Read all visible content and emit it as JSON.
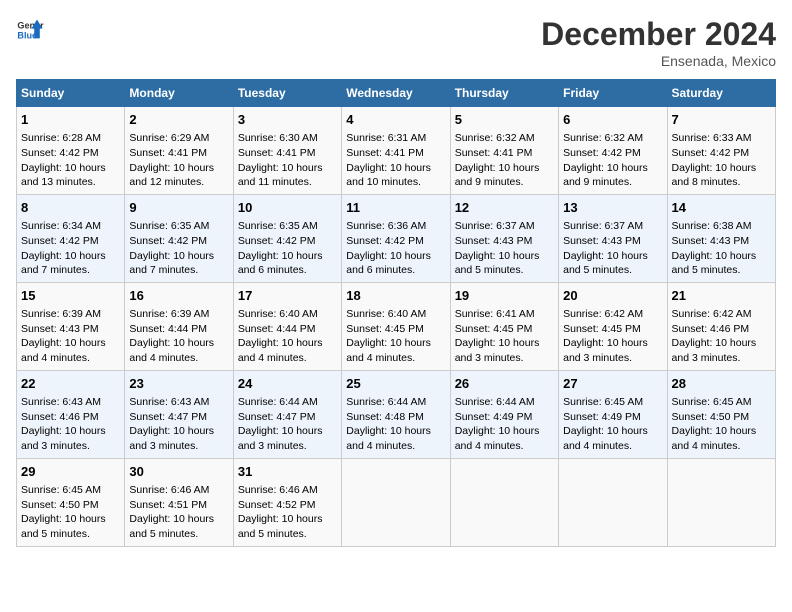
{
  "header": {
    "logo_line1": "General",
    "logo_line2": "Blue",
    "month_title": "December 2024",
    "subtitle": "Ensenada, Mexico"
  },
  "days_of_week": [
    "Sunday",
    "Monday",
    "Tuesday",
    "Wednesday",
    "Thursday",
    "Friday",
    "Saturday"
  ],
  "weeks": [
    [
      {
        "day": "1",
        "sun": "6:28 AM",
        "set": "4:42 PM",
        "dl": "10 hours and 13 minutes."
      },
      {
        "day": "2",
        "sun": "6:29 AM",
        "set": "4:41 PM",
        "dl": "10 hours and 12 minutes."
      },
      {
        "day": "3",
        "sun": "6:30 AM",
        "set": "4:41 PM",
        "dl": "10 hours and 11 minutes."
      },
      {
        "day": "4",
        "sun": "6:31 AM",
        "set": "4:41 PM",
        "dl": "10 hours and 10 minutes."
      },
      {
        "day": "5",
        "sun": "6:32 AM",
        "set": "4:41 PM",
        "dl": "10 hours and 9 minutes."
      },
      {
        "day": "6",
        "sun": "6:32 AM",
        "set": "4:42 PM",
        "dl": "10 hours and 9 minutes."
      },
      {
        "day": "7",
        "sun": "6:33 AM",
        "set": "4:42 PM",
        "dl": "10 hours and 8 minutes."
      }
    ],
    [
      {
        "day": "8",
        "sun": "6:34 AM",
        "set": "4:42 PM",
        "dl": "10 hours and 7 minutes."
      },
      {
        "day": "9",
        "sun": "6:35 AM",
        "set": "4:42 PM",
        "dl": "10 hours and 7 minutes."
      },
      {
        "day": "10",
        "sun": "6:35 AM",
        "set": "4:42 PM",
        "dl": "10 hours and 6 minutes."
      },
      {
        "day": "11",
        "sun": "6:36 AM",
        "set": "4:42 PM",
        "dl": "10 hours and 6 minutes."
      },
      {
        "day": "12",
        "sun": "6:37 AM",
        "set": "4:43 PM",
        "dl": "10 hours and 5 minutes."
      },
      {
        "day": "13",
        "sun": "6:37 AM",
        "set": "4:43 PM",
        "dl": "10 hours and 5 minutes."
      },
      {
        "day": "14",
        "sun": "6:38 AM",
        "set": "4:43 PM",
        "dl": "10 hours and 5 minutes."
      }
    ],
    [
      {
        "day": "15",
        "sun": "6:39 AM",
        "set": "4:43 PM",
        "dl": "10 hours and 4 minutes."
      },
      {
        "day": "16",
        "sun": "6:39 AM",
        "set": "4:44 PM",
        "dl": "10 hours and 4 minutes."
      },
      {
        "day": "17",
        "sun": "6:40 AM",
        "set": "4:44 PM",
        "dl": "10 hours and 4 minutes."
      },
      {
        "day": "18",
        "sun": "6:40 AM",
        "set": "4:45 PM",
        "dl": "10 hours and 4 minutes."
      },
      {
        "day": "19",
        "sun": "6:41 AM",
        "set": "4:45 PM",
        "dl": "10 hours and 3 minutes."
      },
      {
        "day": "20",
        "sun": "6:42 AM",
        "set": "4:45 PM",
        "dl": "10 hours and 3 minutes."
      },
      {
        "day": "21",
        "sun": "6:42 AM",
        "set": "4:46 PM",
        "dl": "10 hours and 3 minutes."
      }
    ],
    [
      {
        "day": "22",
        "sun": "6:43 AM",
        "set": "4:46 PM",
        "dl": "10 hours and 3 minutes."
      },
      {
        "day": "23",
        "sun": "6:43 AM",
        "set": "4:47 PM",
        "dl": "10 hours and 3 minutes."
      },
      {
        "day": "24",
        "sun": "6:44 AM",
        "set": "4:47 PM",
        "dl": "10 hours and 3 minutes."
      },
      {
        "day": "25",
        "sun": "6:44 AM",
        "set": "4:48 PM",
        "dl": "10 hours and 4 minutes."
      },
      {
        "day": "26",
        "sun": "6:44 AM",
        "set": "4:49 PM",
        "dl": "10 hours and 4 minutes."
      },
      {
        "day": "27",
        "sun": "6:45 AM",
        "set": "4:49 PM",
        "dl": "10 hours and 4 minutes."
      },
      {
        "day": "28",
        "sun": "6:45 AM",
        "set": "4:50 PM",
        "dl": "10 hours and 4 minutes."
      }
    ],
    [
      {
        "day": "29",
        "sun": "6:45 AM",
        "set": "4:50 PM",
        "dl": "10 hours and 5 minutes."
      },
      {
        "day": "30",
        "sun": "6:46 AM",
        "set": "4:51 PM",
        "dl": "10 hours and 5 minutes."
      },
      {
        "day": "31",
        "sun": "6:46 AM",
        "set": "4:52 PM",
        "dl": "10 hours and 5 minutes."
      },
      null,
      null,
      null,
      null
    ]
  ]
}
